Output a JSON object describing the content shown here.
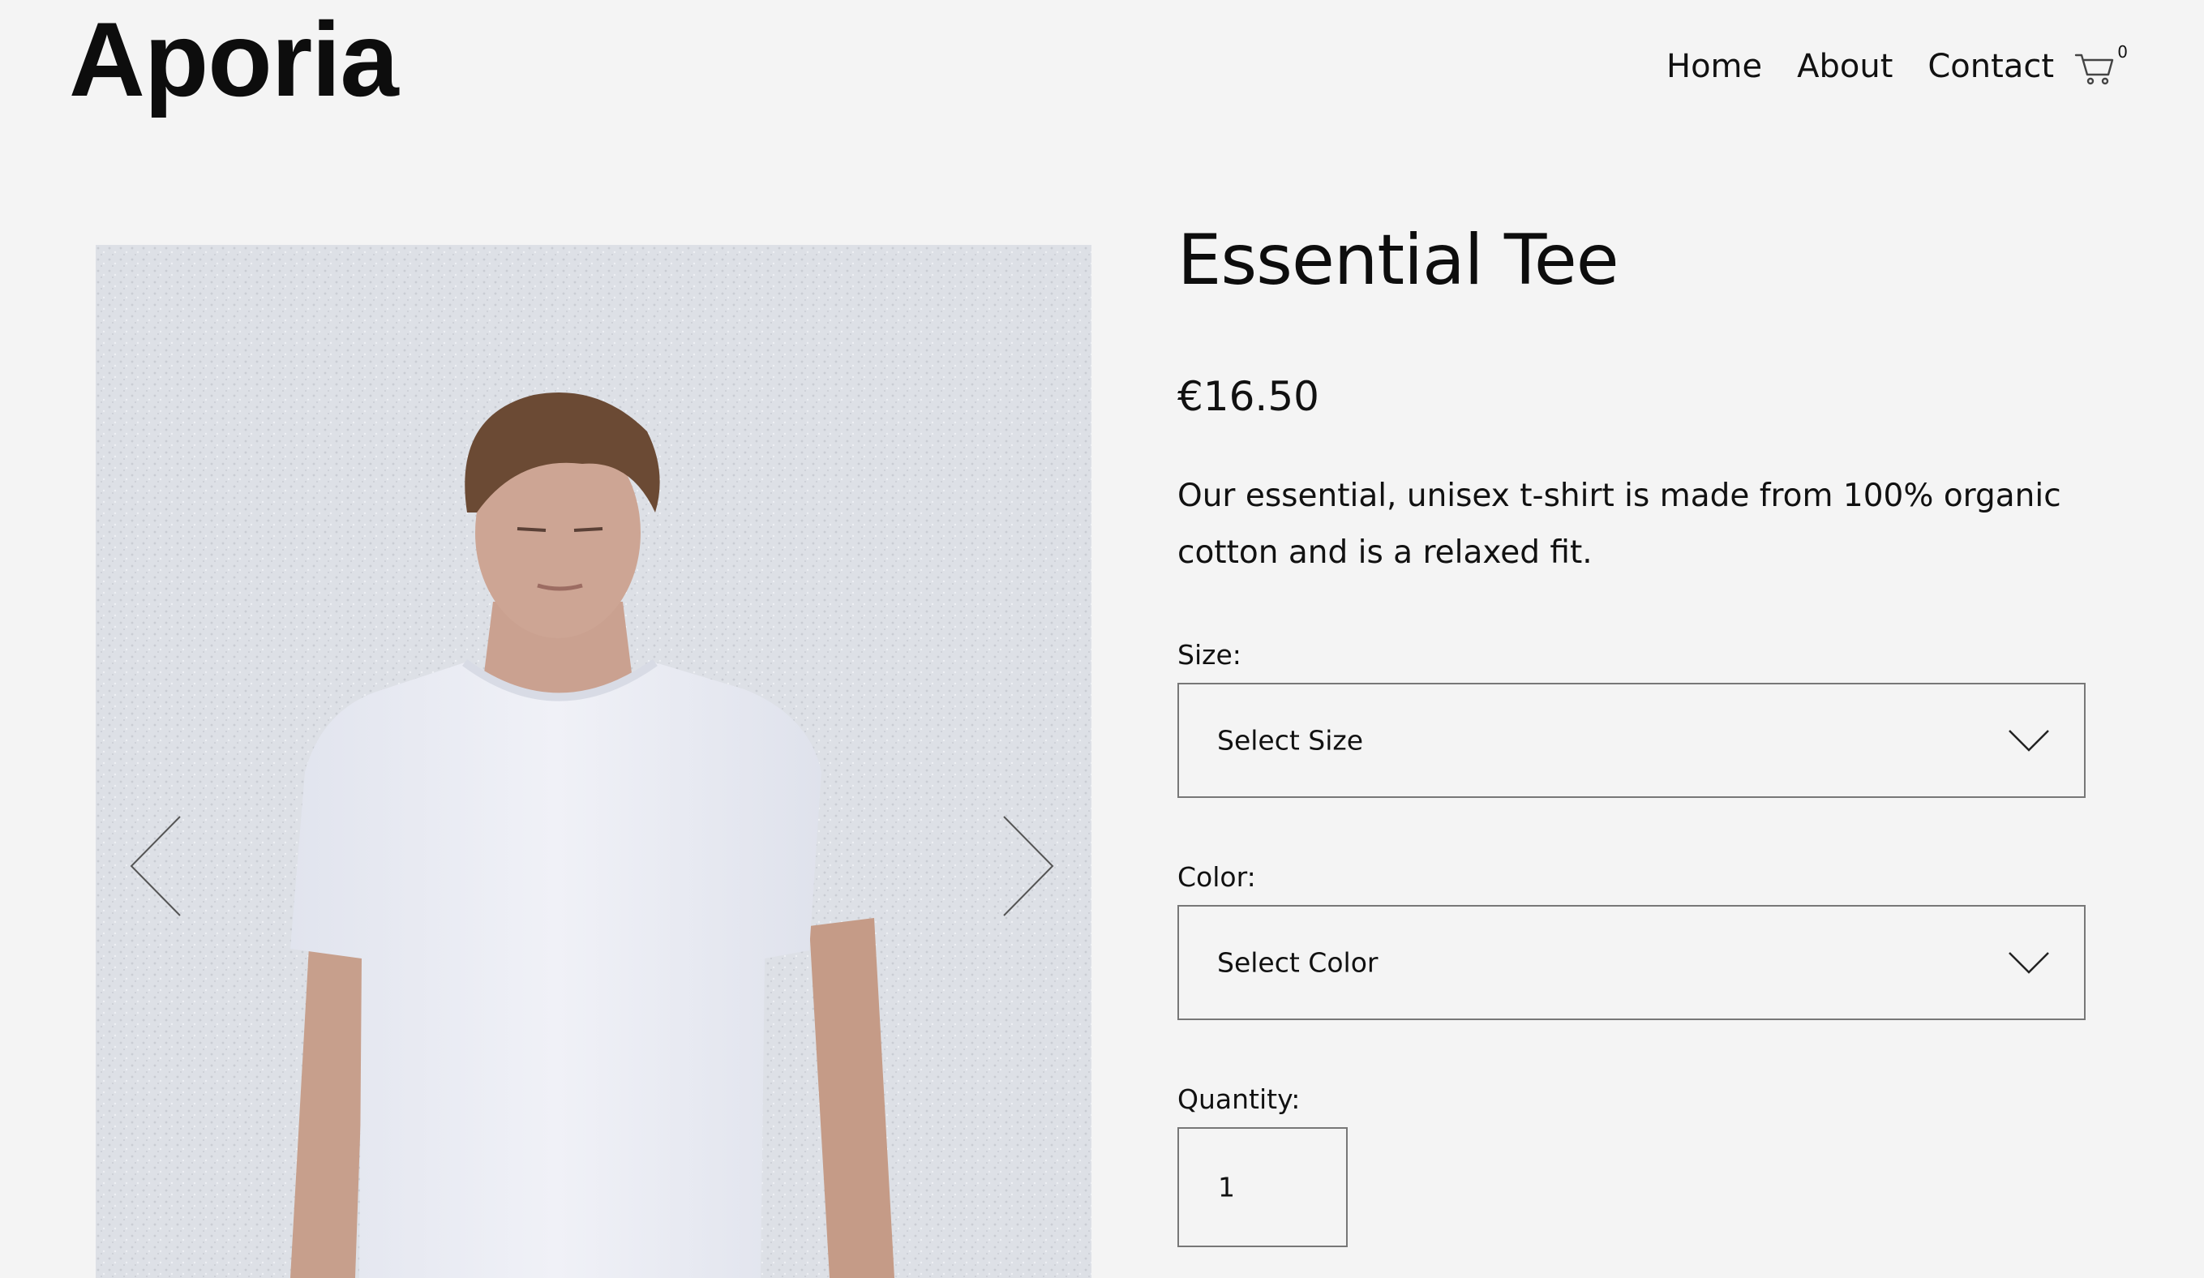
{
  "header": {
    "logo": "Aporia",
    "nav": [
      "Home",
      "About",
      "Contact"
    ],
    "cart_count": "0"
  },
  "product": {
    "title": "Essential Tee",
    "price": "€16.50",
    "description": "Our essential, unisex t-shirt is made from 100% organic cotton and is a relaxed fit.",
    "size_label": "Size:",
    "size_value": "Select Size",
    "color_label": "Color:",
    "color_value": "Select Color",
    "quantity_label": "Quantity:",
    "quantity_value": "1"
  },
  "colors": {
    "background": "#f4f4f4",
    "text": "#111111",
    "border": "#777777",
    "wall": "#dadde3",
    "shirt": "#e9ebf3",
    "hair": "#6b4a34",
    "skin": "#c9a08e"
  }
}
